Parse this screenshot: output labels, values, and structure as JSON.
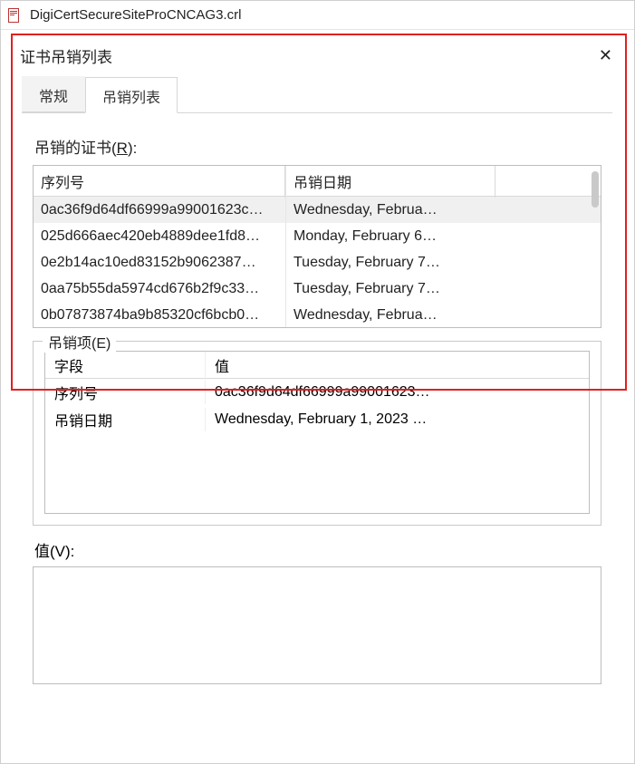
{
  "window": {
    "title": "DigiCertSecureSiteProCNCAG3.crl"
  },
  "dialog": {
    "title": "证书吊销列表"
  },
  "tabs": {
    "general": "常规",
    "revocation": "吊销列表",
    "active_index": 1
  },
  "revoked": {
    "label_prefix": "吊销的证书(",
    "label_hotkey": "R",
    "label_suffix": "):",
    "columns": {
      "serial": "序列号",
      "date": "吊销日期"
    },
    "rows": [
      {
        "serial": "0ac36f9d64df66999a99001623c…",
        "date": "Wednesday, Februa…",
        "selected": true
      },
      {
        "serial": "025d666aec420eb4889dee1fd8…",
        "date": "Monday, February 6…",
        "selected": false
      },
      {
        "serial": "0e2b14ac10ed83152b9062387…",
        "date": "Tuesday, February 7…",
        "selected": false
      },
      {
        "serial": "0aa75b55da5974cd676b2f9c33…",
        "date": "Tuesday, February 7…",
        "selected": false
      },
      {
        "serial": "0b07873874ba9b85320cf6bcb0…",
        "date": "Wednesday, Februa…",
        "selected": false
      }
    ]
  },
  "entry": {
    "legend_prefix": "吊销项(",
    "legend_hotkey": "E",
    "legend_suffix": ")",
    "columns": {
      "field": "字段",
      "value": "值"
    },
    "rows": [
      {
        "field": "序列号",
        "value": "0ac36f9d64df66999a99001623…"
      },
      {
        "field": "吊销日期",
        "value": "Wednesday, February 1, 2023 …"
      }
    ]
  },
  "value": {
    "label_prefix": "值(",
    "label_hotkey": "V",
    "label_suffix": "):",
    "text": ""
  }
}
